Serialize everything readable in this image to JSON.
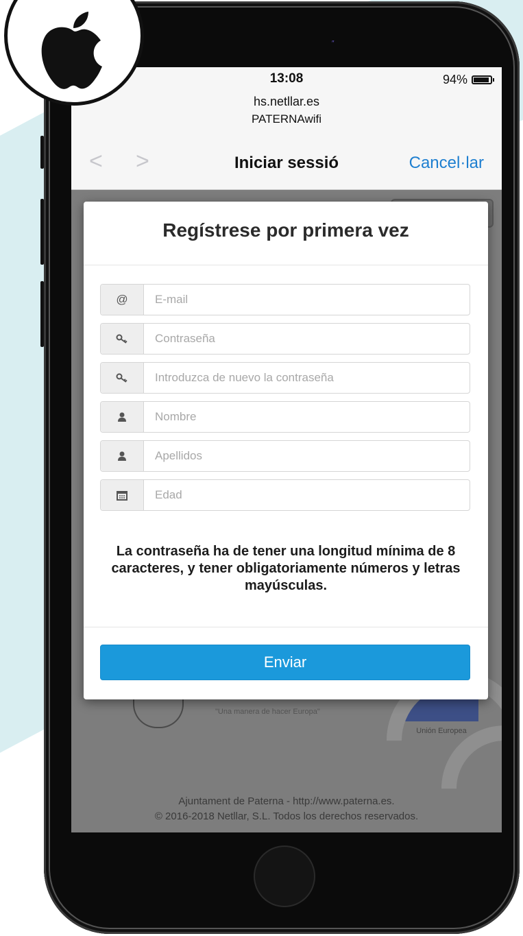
{
  "status_bar": {
    "time": "13:08",
    "battery": "94%"
  },
  "browser": {
    "url": "hs.netllar.es",
    "network": "PATERNAwifi",
    "back_label": "<",
    "forward_label": ">",
    "title": "Iniciar sessió",
    "cancel_label": "Cancel·lar"
  },
  "modal": {
    "title": "Regístrese por primera vez",
    "fields": [
      {
        "icon": "at-icon",
        "placeholder": "E-mail"
      },
      {
        "icon": "key-icon",
        "placeholder": "Contraseña"
      },
      {
        "icon": "key-icon",
        "placeholder": "Introduzca de nuevo la contraseña"
      },
      {
        "icon": "user-icon",
        "placeholder": "Nombre"
      },
      {
        "icon": "user-icon",
        "placeholder": "Apellidos"
      },
      {
        "icon": "calendar-icon",
        "placeholder": "Edad"
      }
    ],
    "notice": "La contraseña ha de tener una longitud mínima de 8 caracteres, y tener obligatoriamente números y letras mayúsculas.",
    "submit_label": "Enviar"
  },
  "background_page": {
    "motto": "\"Una manera de hacer Europa\"",
    "eu_caption": "Unión Europea",
    "footer_line1": "Ajuntament de Paterna - http://www.paterna.es.",
    "footer_line2": "© 2016-2018 Netllar, S.L. Todos los derechos reservados."
  },
  "colors": {
    "accent": "#1b99db",
    "link": "#1e7fd0",
    "background_shape": "#d9eef1"
  }
}
